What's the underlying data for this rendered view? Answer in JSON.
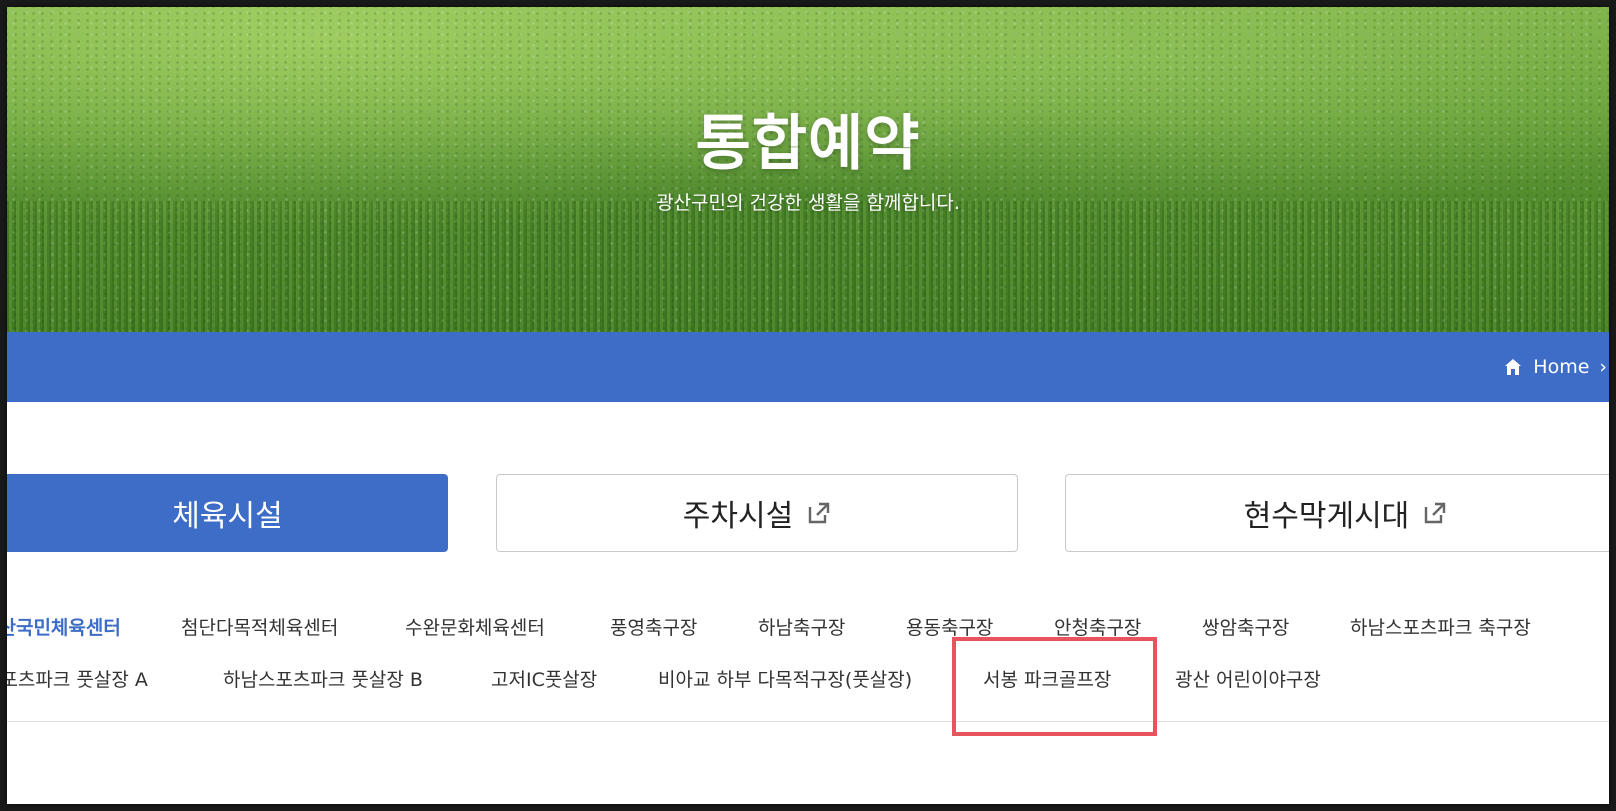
{
  "hero": {
    "title": "통합예약",
    "subtitle": "광산구민의 건강한 생활을 함께합니다."
  },
  "breadcrumb": {
    "home_label": "Home",
    "separator": "›"
  },
  "categories": [
    {
      "label": "체육시설",
      "active": true,
      "external": false
    },
    {
      "label": "주차시설",
      "active": false,
      "external": true
    },
    {
      "label": "현수막게시대",
      "active": false,
      "external": true
    }
  ],
  "facilities_row1": [
    "광산국민체육센터",
    "첨단다목적체육센터",
    "수완문화체육센터",
    "풍영축구장",
    "하남축구장",
    "용동축구장",
    "안청축구장",
    "쌍암축구장",
    "하남스포츠파크 축구장"
  ],
  "facilities_row2": [
    "하남스포츠파크 풋살장 A",
    "하남스포츠파크 풋살장 B",
    "고저IC풋살장",
    "비아교 하부 다목적구장(풋살장)",
    "서봉 파크골프장",
    "광산 어린이야구장"
  ],
  "highlighted_facility": "서봉 파크골프장",
  "colors": {
    "primary": "#3d6dc6",
    "highlight": "#e9535e",
    "text": "#333333"
  }
}
